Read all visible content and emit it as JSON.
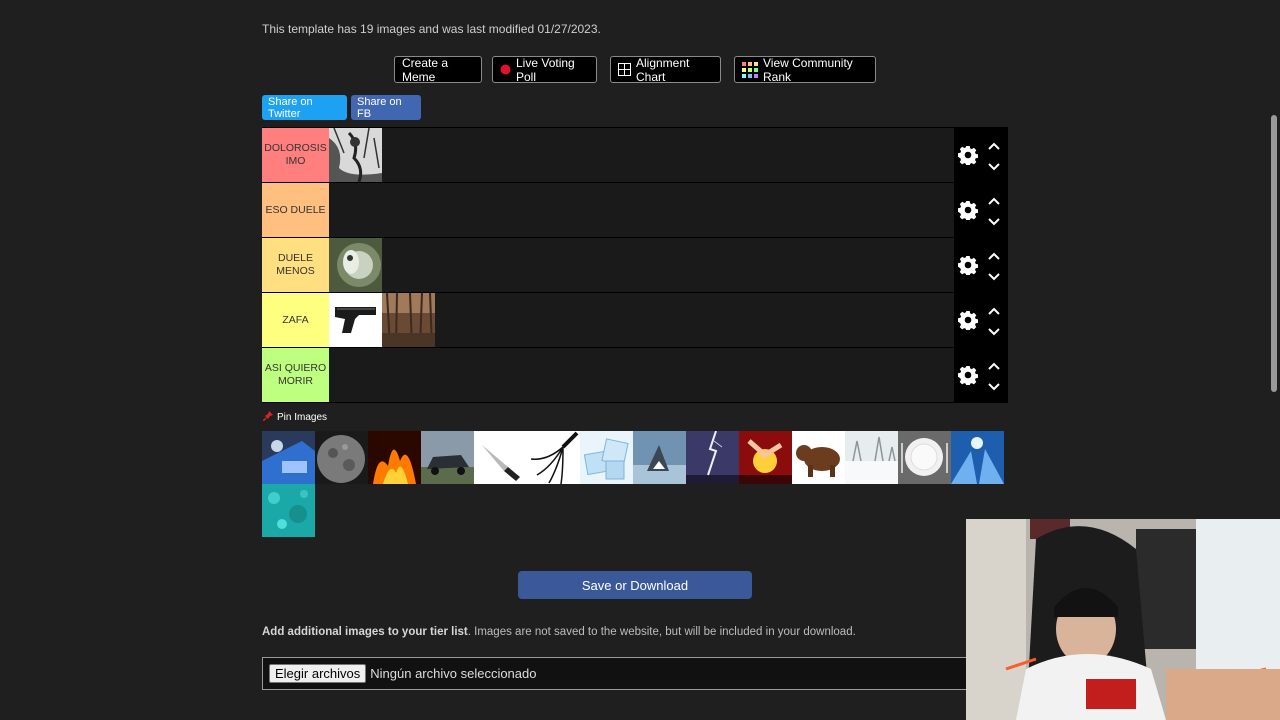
{
  "info": "This template has 19 images and was last modified 01/27/2023.",
  "buttons": {
    "create_meme": "Create a Meme",
    "live_poll": "Live Voting Poll",
    "alignment": "Alignment Chart",
    "community_rank": "View Community Rank"
  },
  "share": {
    "twitter": "Share on Twitter",
    "fb": "Share on FB"
  },
  "tiers": [
    {
      "label": "DOLOROSIS\nIMO",
      "color": "#ff7f7f"
    },
    {
      "label": "ESO DUELE",
      "color": "#ffbf7f"
    },
    {
      "label": "DUELE\nMENOS",
      "color": "#ffdf7f"
    },
    {
      "label": "ZAFA",
      "color": "#ffff7f"
    },
    {
      "label": "ASI QUIERO\nMORIR",
      "color": "#bfff7f"
    }
  ],
  "pin_images": "Pin Images",
  "save": "Save or Download",
  "add_images": {
    "bold": "Add additional images to your tier list",
    "rest": ". Images are not saved to the website, but will be included in your download."
  },
  "file": {
    "button": "Elegir archivos",
    "status": "Ningún archivo seleccionado"
  },
  "colors": {
    "bg": "#1f1f1f",
    "save": "#3b5998",
    "twitter": "#1da1f2",
    "fb": "#4267b2"
  }
}
